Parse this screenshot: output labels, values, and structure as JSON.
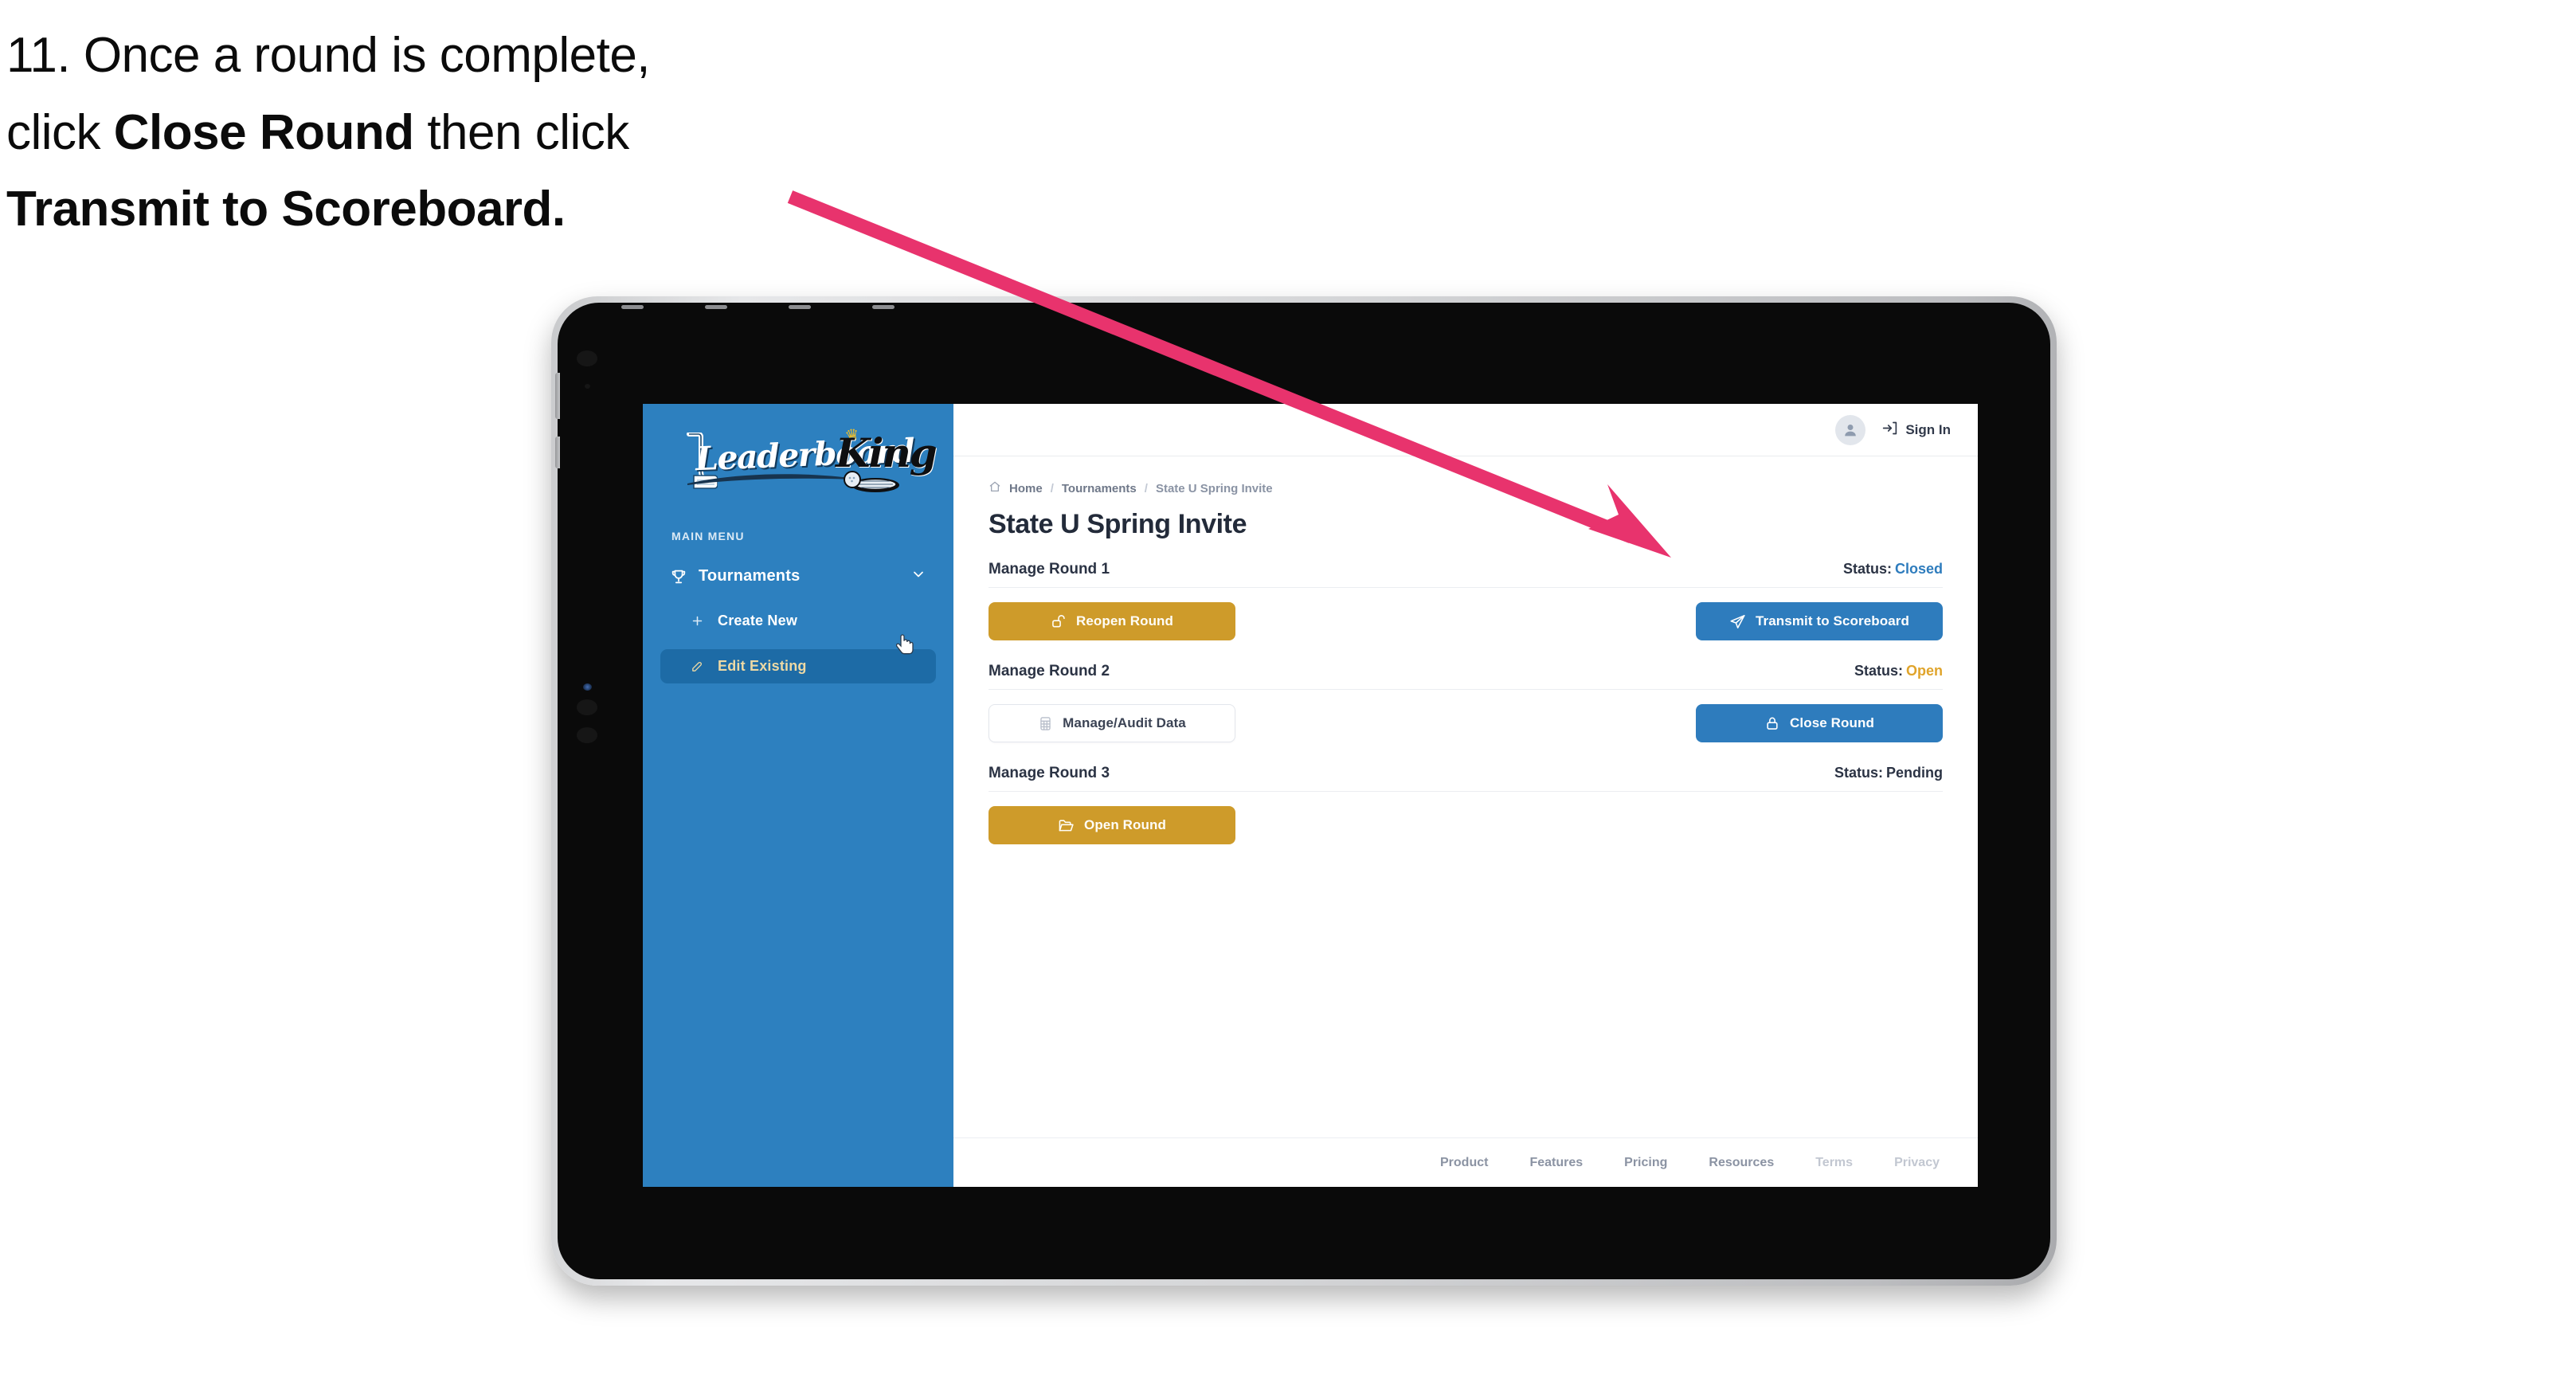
{
  "instruction": {
    "step_number": "11.",
    "line1_a": "11. Once a round is complete,",
    "line2_a": "click ",
    "line2_b": "Close Round",
    "line2_c": " then click",
    "line3_b": "Transmit to Scoreboard."
  },
  "colors": {
    "sidebar_blue": "#2d80bf",
    "sidebar_active": "#1d6ba6",
    "accent_gold": "#ce9b2a",
    "accent_blue": "#2e7cbd",
    "annotation_pink": "#e8336d",
    "status_closed": "#2e7cbd",
    "status_open": "#e0a42b",
    "status_pending": "#2b3344"
  },
  "sidebar": {
    "logo": {
      "word_script": "Leaderboard",
      "word_bold": "King",
      "crown_icon": "crown-icon",
      "putter_icon": "golf-putter-icon",
      "ball_icon": "golf-ball-icon"
    },
    "menu_label": "MAIN MENU",
    "sections": [
      {
        "label": "Tournaments",
        "icon": "trophy-icon",
        "chevron": "chevron-down-icon",
        "items": [
          {
            "label": "Create New",
            "icon": "plus-icon",
            "active": false
          },
          {
            "label": "Edit Existing",
            "icon": "edit-pencil-icon",
            "active": true
          }
        ]
      }
    ]
  },
  "topbar": {
    "avatar_icon": "user-avatar-icon",
    "signin_icon": "sign-in-arrow-icon",
    "signin_label": "Sign In"
  },
  "breadcrumb": {
    "home_icon": "home-icon",
    "items": [
      "Home",
      "Tournaments",
      "State U Spring Invite"
    ],
    "separator": "/"
  },
  "page": {
    "title": "State U Spring Invite"
  },
  "rounds": [
    {
      "name": "Manage Round 1",
      "status_label": "Status:",
      "status_value": "Closed",
      "status_color": "#2e7cbd",
      "left_button": {
        "label": "Reopen Round",
        "icon": "unlock-icon",
        "style": "gold"
      },
      "right_button": {
        "label": "Transmit to Scoreboard",
        "icon": "paper-plane-icon",
        "style": "blue"
      }
    },
    {
      "name": "Manage Round 2",
      "status_label": "Status:",
      "status_value": "Open",
      "status_color": "#e0a42b",
      "left_button": {
        "label": "Manage/Audit Data",
        "icon": "grid-table-icon",
        "style": "ghost"
      },
      "right_button": {
        "label": "Close Round",
        "icon": "lock-icon",
        "style": "blue"
      }
    },
    {
      "name": "Manage Round 3",
      "status_label": "Status:",
      "status_value": "Pending",
      "status_color": "#2b3344",
      "left_button": {
        "label": "Open Round",
        "icon": "open-folder-icon",
        "style": "gold"
      },
      "right_button": null
    }
  ],
  "footer": {
    "links": [
      {
        "label": "Product",
        "muted": false
      },
      {
        "label": "Features",
        "muted": false
      },
      {
        "label": "Pricing",
        "muted": false
      },
      {
        "label": "Resources",
        "muted": false
      },
      {
        "label": "Terms",
        "muted": true
      },
      {
        "label": "Privacy",
        "muted": true
      }
    ]
  }
}
